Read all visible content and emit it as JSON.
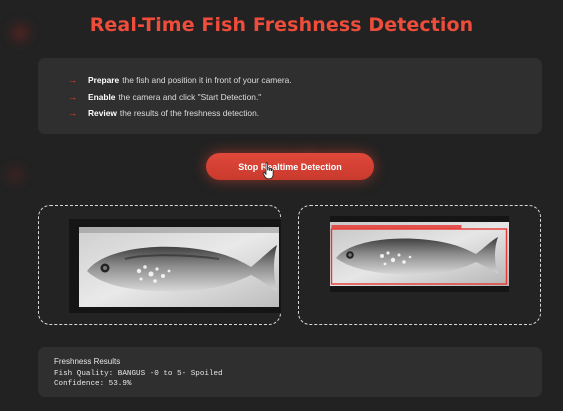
{
  "header": {
    "title": "Real-Time Fish Freshness Detection"
  },
  "instructions": [
    {
      "bold": "Prepare",
      "text": "the fish and position it in front of your camera."
    },
    {
      "bold": "Enable",
      "text": "the camera and click \"Start Detection.\""
    },
    {
      "bold": "Review",
      "text": "the results of the freshness detection."
    }
  ],
  "controls": {
    "stop_label": "Stop Realtime Detection"
  },
  "camera": {
    "live_feed_icon": "fish-photo",
    "detected_feed_icon": "fish-photo-with-detection-box"
  },
  "results": {
    "title": "Freshness Results",
    "quality_line": "Fish Quality: BANGUS -0 to 5- Spoiled",
    "confidence_line": "Confidence: 53.9%"
  },
  "colors": {
    "accent": "#ef4d3b",
    "background": "#222222",
    "card": "#2f2f2f",
    "detection_box": "#e53935"
  }
}
